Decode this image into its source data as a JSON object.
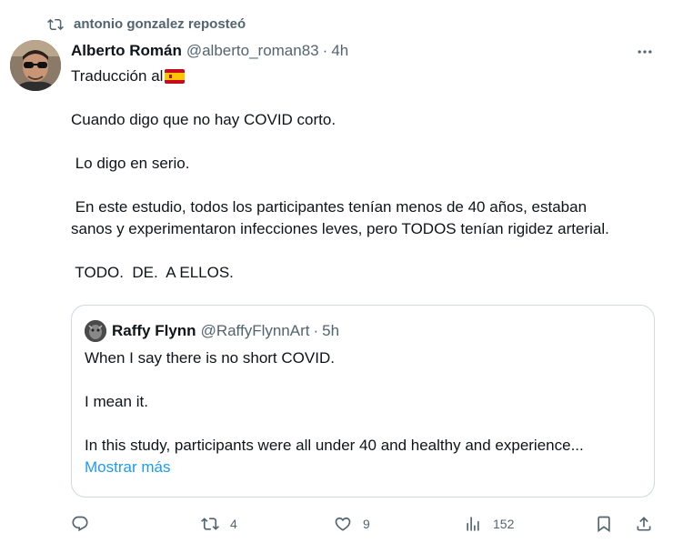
{
  "retweet": {
    "text": "antonio gonzalez reposteó",
    "icon": "retweet-icon"
  },
  "tweet": {
    "author_name": "Alberto Román",
    "author_handle": "@alberto_roman83",
    "separator": "·",
    "time": "4h",
    "lines": [
      "Traducción al",
      "",
      "Cuando digo que no hay COVID corto.",
      "",
      " Lo digo en serio.",
      "",
      " En este estudio, todos los participantes tenían menos de 40 años, estaban",
      "sanos y experimentaron infecciones leves, pero TODOS tenían rigidez arterial.",
      "",
      " TODO.  DE.  A ELLOS."
    ],
    "flag_icon": "spain-flag-icon"
  },
  "quote": {
    "author_name": "Raffy Flynn",
    "author_handle": "@RaffyFlynnArt",
    "separator": "·",
    "time": "5h",
    "lines": [
      "When I say there is no short COVID.",
      "",
      "I mean it.",
      "",
      "In this study, participants were all under 40 and healthy and experience..."
    ],
    "show_more": "Mostrar más"
  },
  "actions": {
    "reply": {
      "icon": "reply-icon",
      "count": ""
    },
    "repost": {
      "icon": "repost-icon",
      "count": "4"
    },
    "like": {
      "icon": "heart-icon",
      "count": "9"
    },
    "views": {
      "icon": "views-icon",
      "count": "152"
    },
    "bookmark": {
      "icon": "bookmark-icon"
    },
    "share": {
      "icon": "share-icon"
    }
  },
  "colors": {
    "text": "#0f1419",
    "muted": "#536471",
    "link": "#1d9bf0",
    "border": "#cfd9de"
  }
}
